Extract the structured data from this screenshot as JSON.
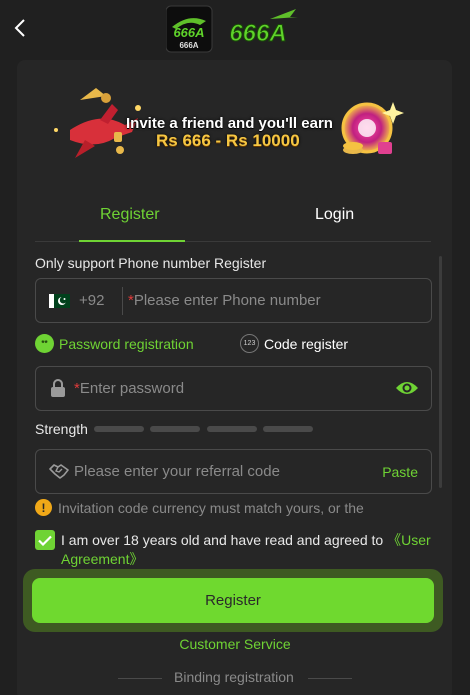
{
  "brand": {
    "logo_text": "666A",
    "logo_small_text": "666A"
  },
  "banner": {
    "line1": "Invite a friend and you'll earn",
    "line2": "Rs 666 - Rs 10000"
  },
  "tabs": [
    {
      "label": "Register",
      "active": true
    },
    {
      "label": "Login",
      "active": false
    }
  ],
  "form": {
    "support_text": "Only support Phone number Register",
    "phone": {
      "country_code": "+92",
      "placeholder": "Please enter Phone number",
      "required_mark": "*"
    },
    "registration_options": [
      {
        "label": "Password registration",
        "icon_text": "**",
        "selected": true
      },
      {
        "label": "Code register",
        "icon_text": "123",
        "selected": false
      }
    ],
    "password": {
      "placeholder": "Enter password",
      "required_mark": "*"
    },
    "strength": {
      "label": "Strength",
      "level": 0,
      "segments": 4
    },
    "referral": {
      "placeholder": "Please enter your referral code",
      "paste_label": "Paste"
    },
    "warning": {
      "icon_text": "!",
      "text": "Invitation code currency must match yours, or the"
    },
    "agreement": {
      "checked": true,
      "text": "I am over 18 years old and have read and agreed to ",
      "link": "《User Agreement》"
    },
    "register_button": "Register",
    "customer_service": "Customer Service",
    "binding_registration": "Binding registration"
  },
  "colors": {
    "accent": "#6fd334",
    "background": "#202020",
    "panel": "#262626",
    "required": "#e03b3b",
    "warning": "#f0a818"
  }
}
